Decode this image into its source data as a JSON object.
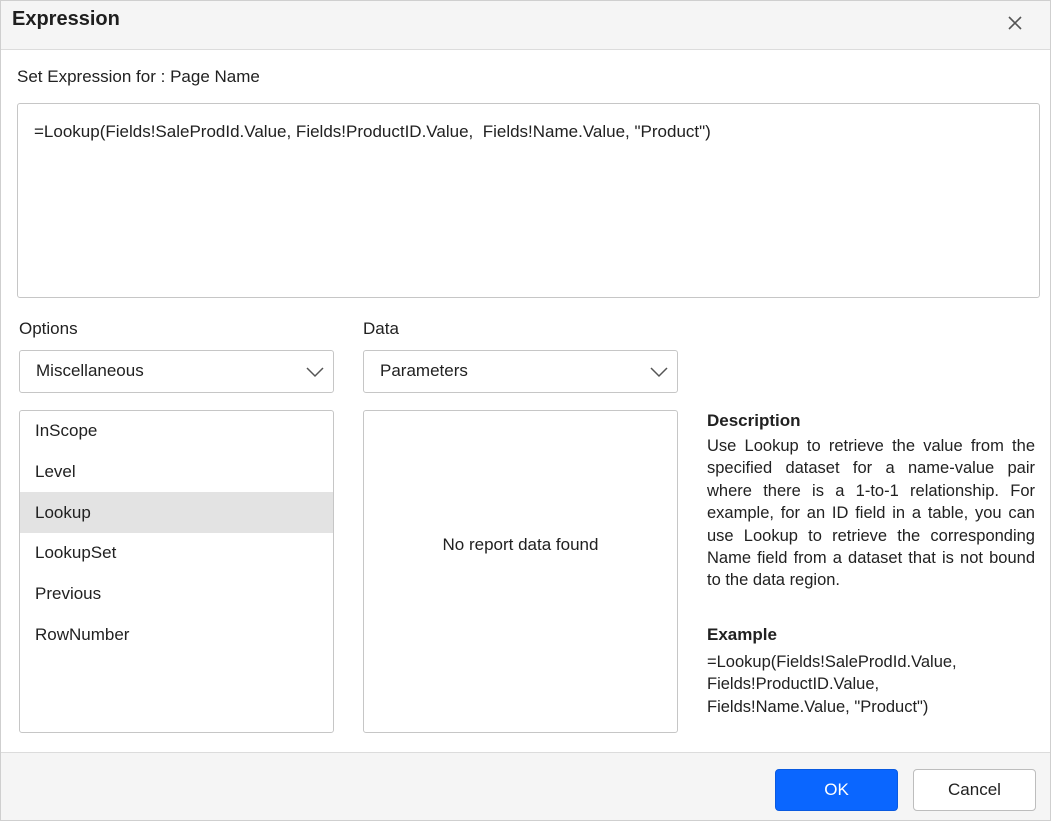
{
  "dialog": {
    "title": "Expression",
    "close_icon": "close-icon"
  },
  "expression": {
    "label": "Set Expression for : Page Name",
    "value": "=Lookup(Fields!SaleProdId.Value, Fields!ProductID.Value,  Fields!Name.Value, \"Product\")"
  },
  "options": {
    "label": "Options",
    "selected": "Miscellaneous",
    "items": [
      {
        "label": "InScope",
        "selected": false
      },
      {
        "label": "Level",
        "selected": false
      },
      {
        "label": "Lookup",
        "selected": true
      },
      {
        "label": "LookupSet",
        "selected": false
      },
      {
        "label": "Previous",
        "selected": false
      },
      {
        "label": "RowNumber",
        "selected": false
      }
    ]
  },
  "data": {
    "label": "Data",
    "selected": "Parameters",
    "empty_message": "No report data found"
  },
  "description": {
    "title": "Description",
    "text": "Use Lookup to retrieve the value from the specified dataset for a name-value pair where there is a 1-to-1 relationship. For example, for an ID field in a table, you can use Lookup to retrieve the corresponding Name field from a dataset that is not bound to the data region.",
    "example_title": "Example",
    "example_text": "=Lookup(Fields!SaleProdId.Value, Fields!ProductID.Value, Fields!Name.Value, \"Product\")"
  },
  "footer": {
    "ok_label": "OK",
    "cancel_label": "Cancel"
  },
  "colors": {
    "primary": "#0a66ff",
    "selected_row": "#e3e3e3",
    "header_bg": "#f5f5f5"
  }
}
